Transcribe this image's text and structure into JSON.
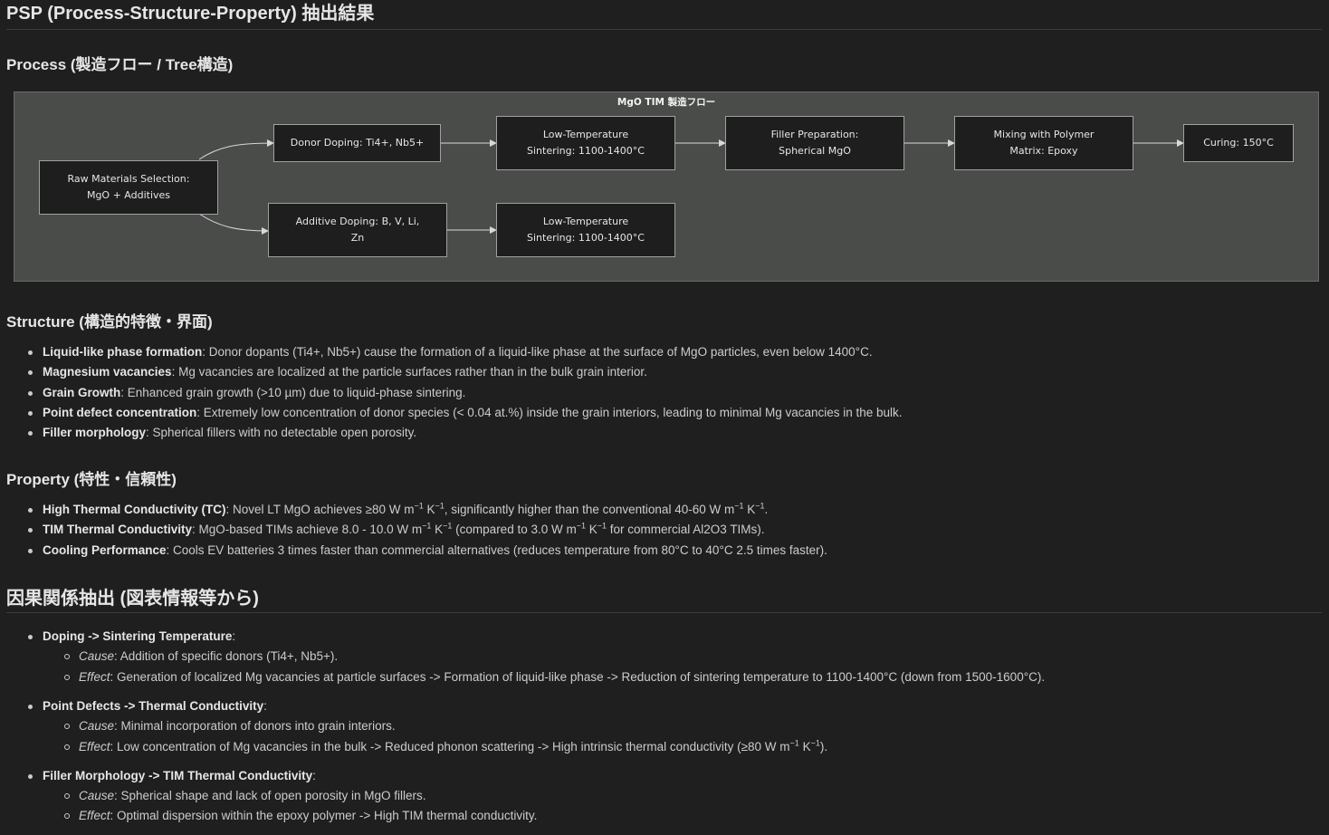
{
  "title": "PSP (Process-Structure-Property) 抽出結果",
  "process": {
    "heading": "Process (製造フロー / Tree構造)",
    "diagram_title": "MgO TIM 製造フロー",
    "nodes": {
      "raw": "Raw Materials Selection:\nMgO + Additives",
      "donor": "Donor Doping: Ti4+, Nb5+",
      "sinter1": "Low-Temperature\nSintering: 1100-1400°C",
      "filler": "Filler Preparation:\nSpherical MgO",
      "mixing": "Mixing with Polymer\nMatrix: Epoxy",
      "curing": "Curing: 150°C",
      "additive": "Additive Doping: B, V, Li,\nZn",
      "sinter2": "Low-Temperature\nSintering: 1100-1400°C"
    }
  },
  "structure": {
    "heading": "Structure (構造的特徴・界面)",
    "items": [
      {
        "term": "Liquid-like phase formation",
        "text": ": Donor dopants (Ti4+, Nb5+) cause the formation of a liquid-like phase at the surface of MgO particles, even below 1400°C."
      },
      {
        "term": "Magnesium vacancies",
        "text": ": Mg vacancies are localized at the particle surfaces rather than in the bulk grain interior."
      },
      {
        "term": "Grain Growth",
        "text": ": Enhanced grain growth (>10 µm) due to liquid-phase sintering."
      },
      {
        "term": "Point defect concentration",
        "text": ": Extremely low concentration of donor species (< 0.04 at.%) inside the grain interiors, leading to minimal Mg vacancies in the bulk."
      },
      {
        "term": "Filler morphology",
        "text": ": Spherical fillers with no detectable open porosity."
      }
    ]
  },
  "property": {
    "heading": "Property (特性・信頼性)",
    "items": [
      {
        "term": "High Thermal Conductivity (TC)",
        "a": ": Novel LT MgO achieves ≥80 W m",
        "b": " K",
        "c": ", significantly higher than the conventional 40-60 W m",
        "d": " K",
        "e": ".",
        "exp": "−1"
      },
      {
        "term": "TIM Thermal Conductivity",
        "a": ": MgO-based TIMs achieve 8.0 - 10.0 W m",
        "b": " K",
        "c": " (compared to 3.0 W m",
        "d": " K",
        "e": " for commercial Al2O3 TIMs).",
        "exp": "−1"
      },
      {
        "term": "Cooling Performance",
        "text": ": Cools EV batteries 3 times faster than commercial alternatives (reduces temperature from 80°C to 40°C 2.5 times faster)."
      }
    ]
  },
  "causal": {
    "heading": "因果関係抽出 (図表情報等から)",
    "cause_label": "Cause",
    "effect_label": "Effect",
    "items": [
      {
        "term": "Doping -> Sintering Temperature",
        "colon": ":",
        "cause": ": Addition of specific donors (Ti4+, Nb5+).",
        "effect": ": Generation of localized Mg vacancies at particle surfaces -> Formation of liquid-like phase -> Reduction of sintering temperature to 1100-1400°C (down from 1500-1600°C)."
      },
      {
        "term": "Point Defects -> Thermal Conductivity",
        "colon": ":",
        "cause": ": Minimal incorporation of donors into grain interiors.",
        "effect_a": ": Low concentration of Mg vacancies in the bulk -> Reduced phonon scattering -> High intrinsic thermal conductivity (≥80 W m",
        "effect_b": " K",
        "effect_c": ")."
      },
      {
        "term": "Filler Morphology -> TIM Thermal Conductivity",
        "colon": ":",
        "cause": ": Spherical shape and lack of open porosity in MgO fillers.",
        "effect": ": Optimal dispersion within the epoxy polymer -> High TIM thermal conductivity."
      }
    ]
  }
}
